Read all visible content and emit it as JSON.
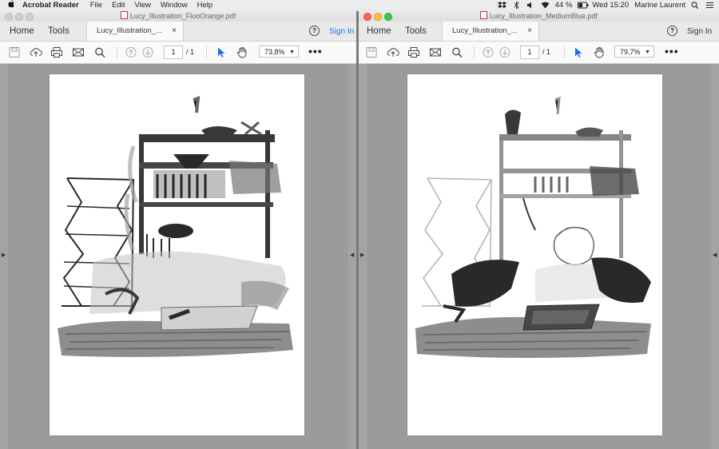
{
  "menubar": {
    "app_name": "Acrobat Reader",
    "menus": [
      "File",
      "Edit",
      "View",
      "Window",
      "Help"
    ],
    "battery": "44 %",
    "clock": "Wed 15:20",
    "user": "Marine Laurent"
  },
  "windows": [
    {
      "title": "Lucy_Illustration_FluoOrange.pdf",
      "nav": {
        "home": "Home",
        "tools": "Tools"
      },
      "tab_label": "Lucy_Illustration_...",
      "tab_close": "×",
      "help": "?",
      "sign_in": "Sign In",
      "sign_in_color": "#1473e6",
      "page_current": "1",
      "page_total": "/ 1",
      "zoom": "73,8%",
      "more": "•••"
    },
    {
      "title": "Lucy_Illustration_MediumBlue.pdf",
      "nav": {
        "home": "Home",
        "tools": "Tools"
      },
      "tab_label": "Lucy_Illustration_...",
      "tab_close": "×",
      "help": "?",
      "sign_in": "Sign In",
      "sign_in_color": "#333333",
      "page_current": "1",
      "page_total": "/ 1",
      "zoom": "79,7%",
      "more": "•••"
    }
  ],
  "icons": [
    "apple-icon",
    "dropbox-icon",
    "bluetooth-icon",
    "volume-icon",
    "wifi-icon",
    "battery-icon",
    "search-icon",
    "save-icon",
    "upload-icon",
    "print-icon",
    "email-icon",
    "zoom-search-icon",
    "page-up-icon",
    "page-down-icon",
    "select-arrow-icon",
    "hand-icon"
  ],
  "accent": "#1473e6"
}
